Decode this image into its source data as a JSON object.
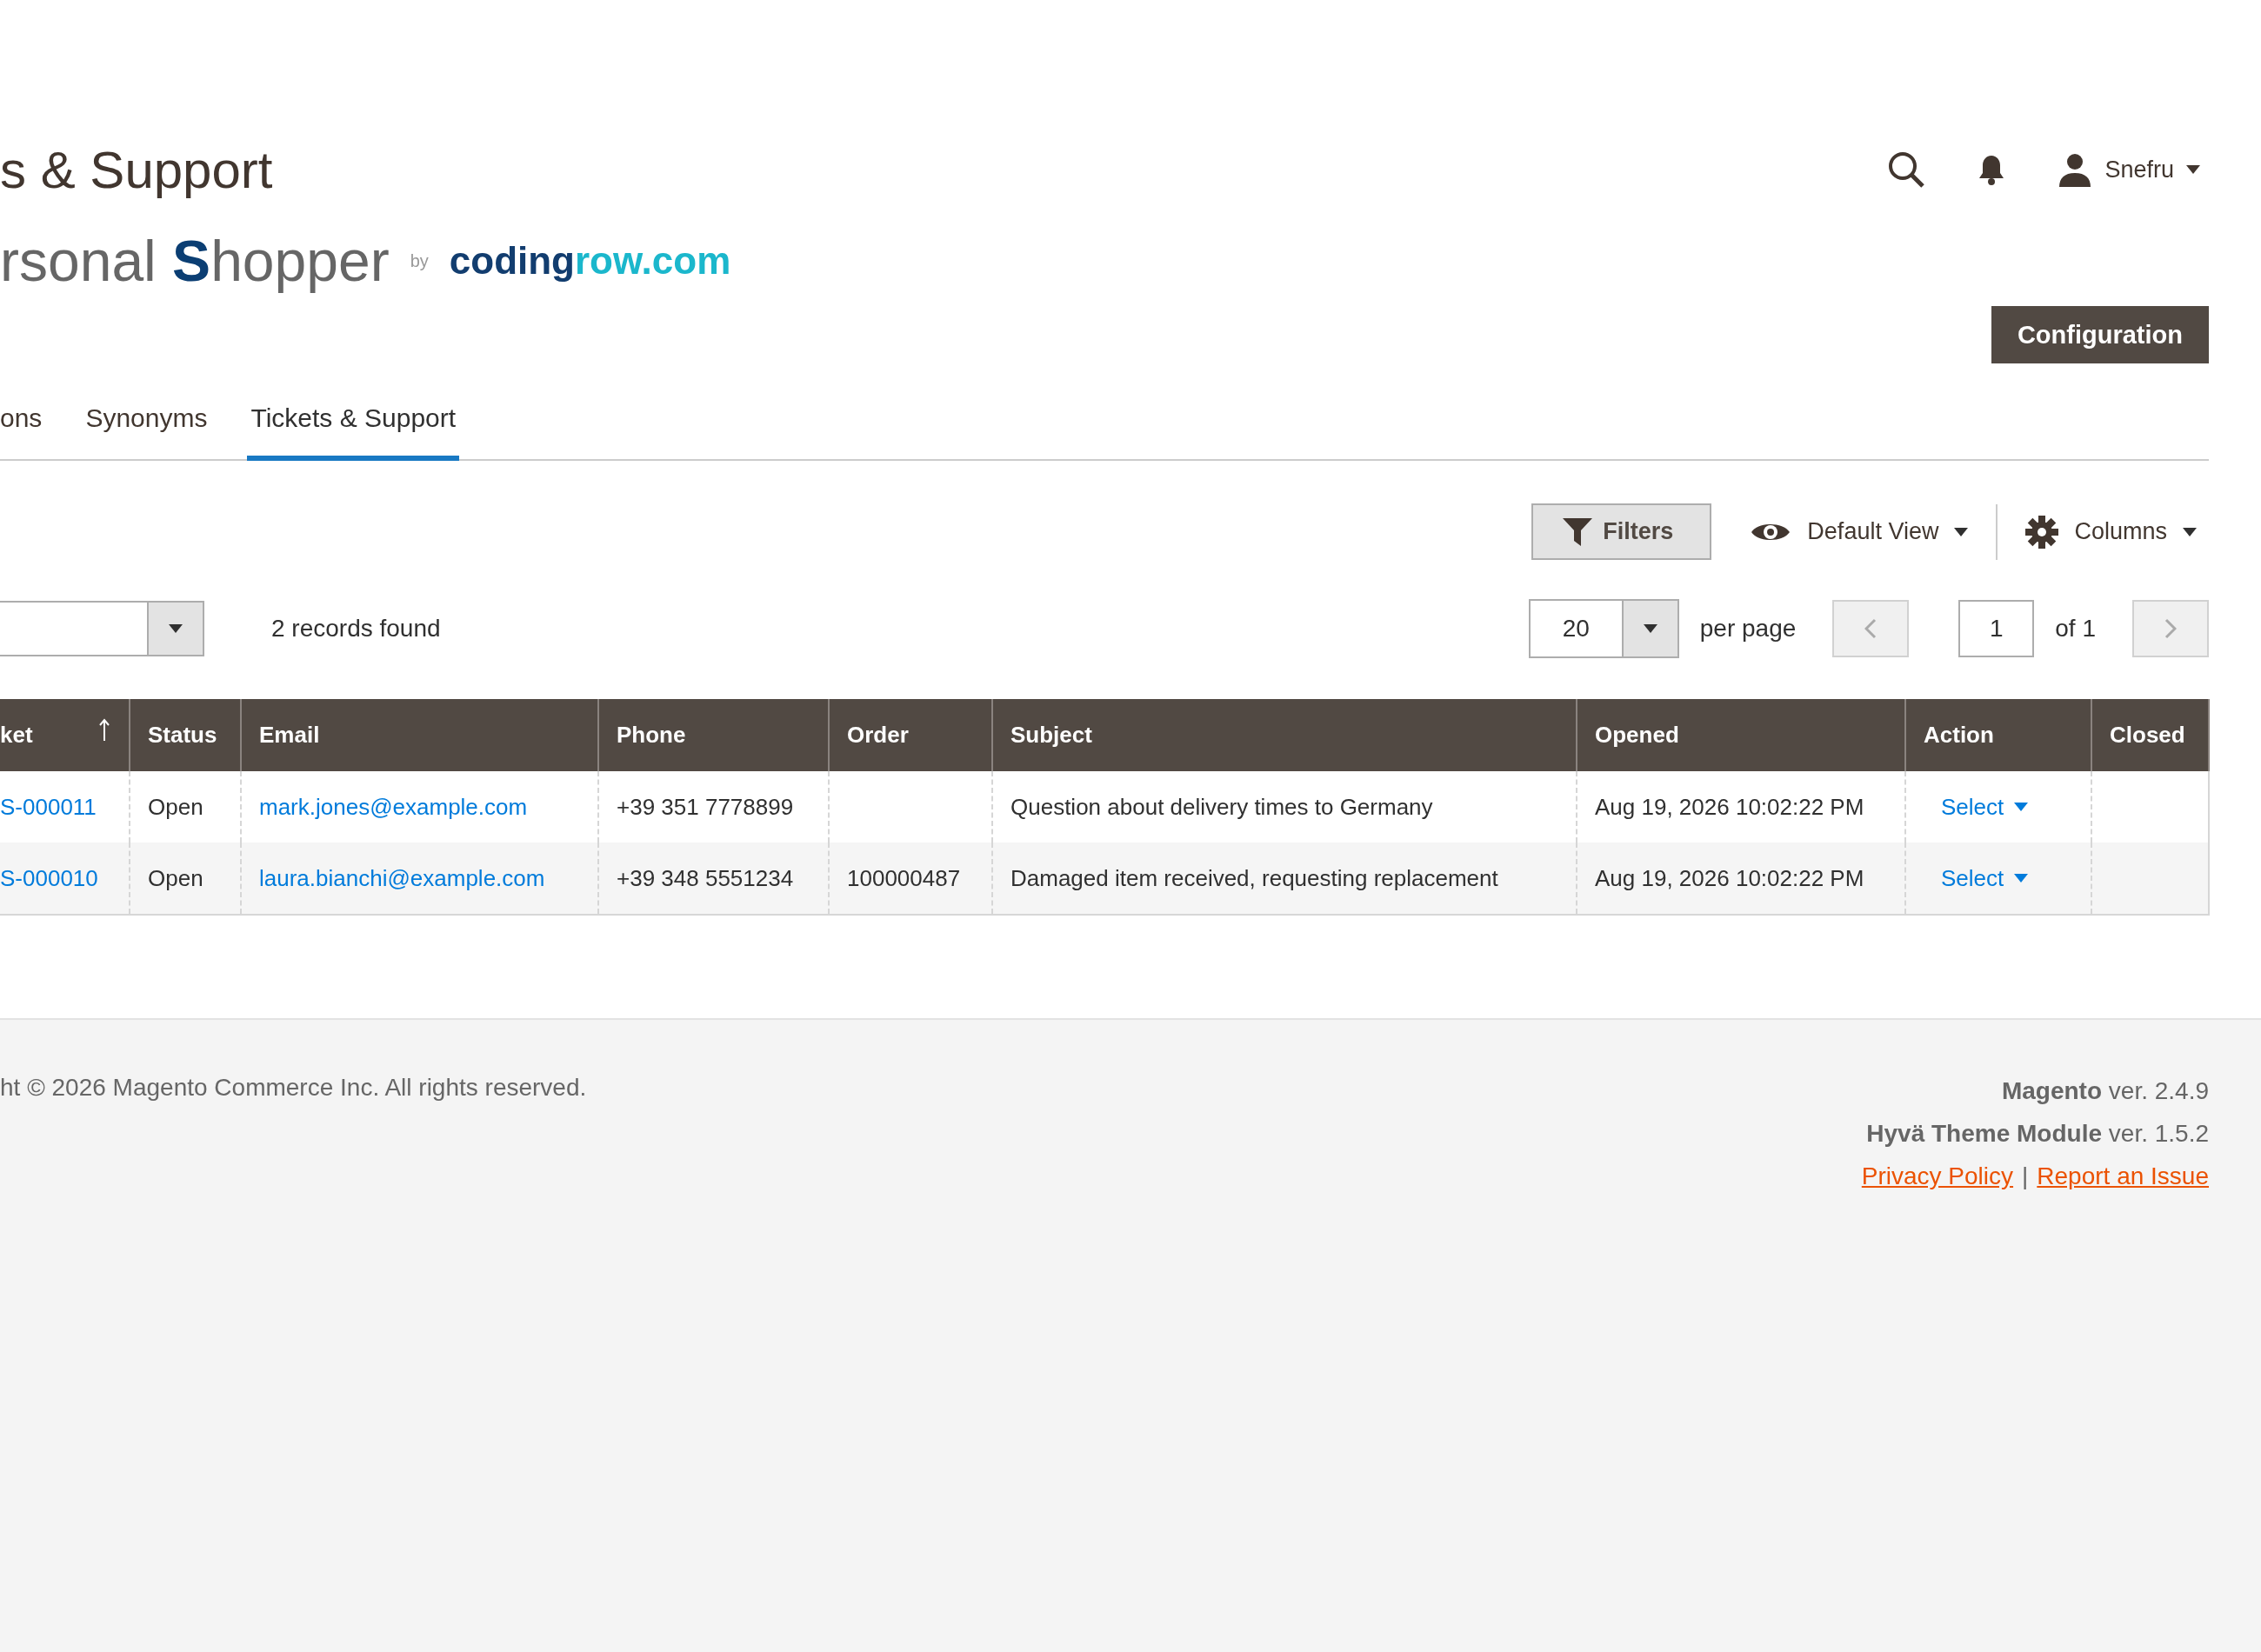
{
  "header": {
    "title": "s & Support",
    "user": "Snefru"
  },
  "brand": {
    "product": "rsonal **S**hopper",
    "by": "by",
    "vendor": "**coding**row.com"
  },
  "primary_action": "Configuration",
  "tabs": [
    {
      "label": "ons",
      "selected": false
    },
    {
      "label": "Synonyms",
      "selected": false
    },
    {
      "label": "Tickets & Support",
      "selected": true
    }
  ],
  "toolbar": {
    "filters": "Filters",
    "view": "Default View",
    "columns": "Columns"
  },
  "pager": {
    "records": "2 records found",
    "per_page_value": "20",
    "per_page_label": "per page",
    "page": "1",
    "page_total": "of 1"
  },
  "table": {
    "columns": [
      {
        "kind": "link",
        "label": "ket",
        "sorted": true
      },
      {
        "kind": "text",
        "label": "Status",
        "sorted": false
      },
      {
        "kind": "link",
        "label": "Email",
        "sorted": false
      },
      {
        "kind": "text",
        "label": "Phone",
        "sorted": false
      },
      {
        "kind": "text",
        "label": "Order",
        "sorted": false
      },
      {
        "kind": "text",
        "label": "Subject",
        "sorted": false
      },
      {
        "kind": "text",
        "label": "Opened",
        "sorted": false
      },
      {
        "kind": "action",
        "label": "Action",
        "sorted": false
      },
      {
        "label": "Closed",
        "sorted": false
      }
    ],
    "rows": [
      {
        "cells": [
          "S-000011",
          "Open",
          "mark.jones@example.com",
          "+39 351 7778899",
          null,
          "Question about delivery times to Germany",
          "Aug 19, 2026 10:02:22 PM",
          "Select",
          null
        ]
      },
      {
        "cells": [
          "S-000010",
          "Open",
          "laura.bianchi@example.com",
          "+39 348 5551234",
          "100000487",
          "Damaged item received, requesting replacement",
          "Aug 19, 2026 10:02:22 PM",
          "Select",
          null
        ]
      }
    ]
  },
  "footer": {
    "copyright": "ht © 2026 Magento Commerce Inc. All rights reserved.",
    "versions": [
      "**Magento** ver. 2.4.9",
      "**Hyvä Theme Module** ver. 1.5.2"
    ],
    "links": [
      "Privacy Policy",
      "Report an Issue"
    ],
    "separator": "|"
  }
}
